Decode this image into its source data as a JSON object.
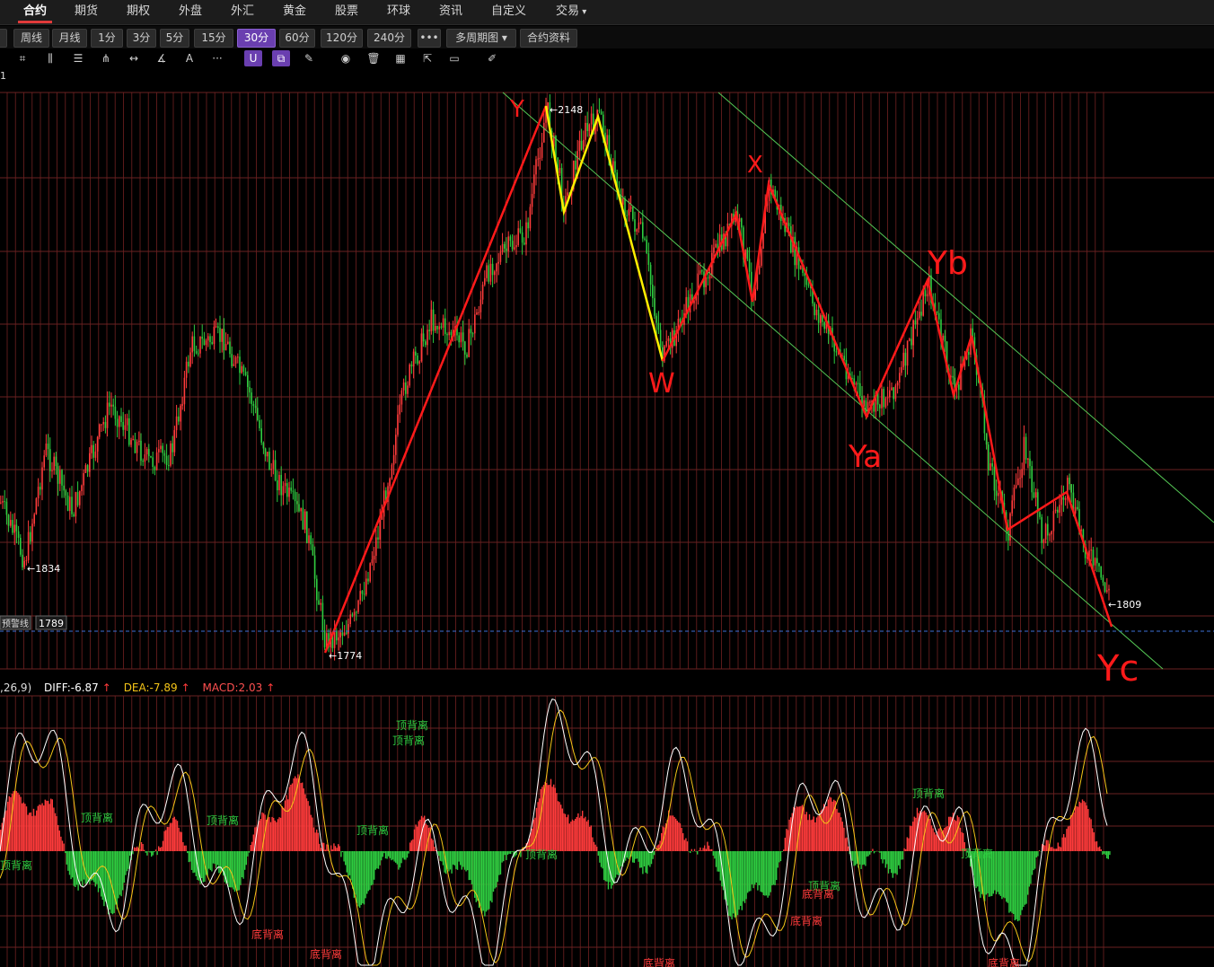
{
  "menu": {
    "items": [
      "合约",
      "期货",
      "期权",
      "外盘",
      "外汇",
      "黄金",
      "股票",
      "环球",
      "资讯",
      "自定义",
      "交易"
    ],
    "active_index": 0,
    "dropdown_caret": "▾"
  },
  "periods": {
    "buttons": [
      "周线",
      "月线",
      "1分",
      "3分",
      "5分",
      "15分",
      "30分",
      "60分",
      "120分",
      "240分"
    ],
    "active": "30分",
    "more_label": "•••",
    "multi_period_label": "多周期图",
    "contract_info_label": "合约资料"
  },
  "toolbar": {
    "tools": [
      "crop-icon",
      "bars-icon",
      "lines-icon",
      "fan-icon",
      "range-icon",
      "angle-icon",
      "text-icon",
      "more-icon",
      "magnet-icon",
      "copy-icon",
      "pen-icon",
      "eye-icon",
      "delete-icon",
      "layers-icon",
      "export-icon",
      "comment-icon",
      "brush-icon"
    ],
    "text_label": "A",
    "more_label": "···"
  },
  "chart_header": {
    "label": "1"
  },
  "price_labels": {
    "high": "2148",
    "low_left": "1834",
    "low": "1774",
    "last": "1809",
    "alert_button": "预警线",
    "alert_value": "1789"
  },
  "wave_labels": {
    "y": "Y",
    "w": "W",
    "x": "X",
    "ya": "Ya",
    "yb": "Yb",
    "yc": "Yc"
  },
  "macd": {
    "params": ",26,9)",
    "diff": "DIFF:-6.87",
    "dea": "DEA:-7.89",
    "macd": "MACD:2.03",
    "top_divergence": "顶背离",
    "bottom_divergence": "底背离"
  },
  "colors": {
    "up": "#ff3b3b",
    "down": "#2ecc40",
    "wave_red": "#ff1a1a",
    "wave_yellow": "#ffee00",
    "channel": "#55c855",
    "grid": "#5a1a1a",
    "accent": "#6a3fb0",
    "diff_line": "#ffffff",
    "dea_line": "#f5c518"
  }
}
